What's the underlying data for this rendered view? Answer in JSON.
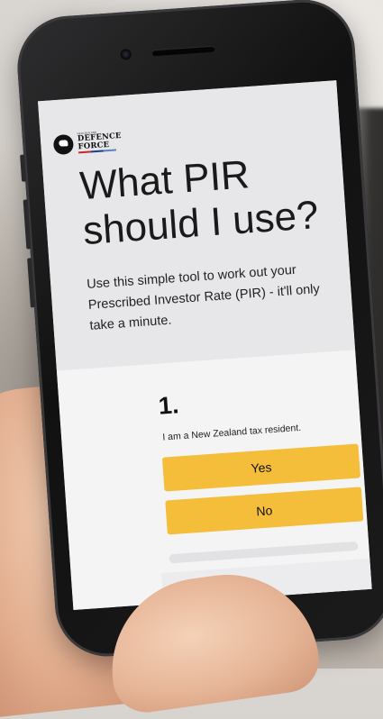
{
  "logo": {
    "small_text": "NEW ZEALAND",
    "line1": "DEFENCE",
    "line2": "FORCE"
  },
  "hero": {
    "title_line1": "What PIR",
    "title_line2": "should I use?",
    "subtitle": "Use this simple tool to work out your Prescribed Investor Rate (PIR) - it'll only take a minute."
  },
  "question": {
    "number": "1.",
    "text": "I am a New Zealand tax resident.",
    "options": [
      {
        "label": "Yes"
      },
      {
        "label": "No"
      }
    ]
  },
  "colors": {
    "button": "#f4be3b",
    "hero_background": "#e7e7e9",
    "screen_background": "#f4f4f5"
  },
  "icons": {
    "logo": "kiwi-logo-icon"
  }
}
